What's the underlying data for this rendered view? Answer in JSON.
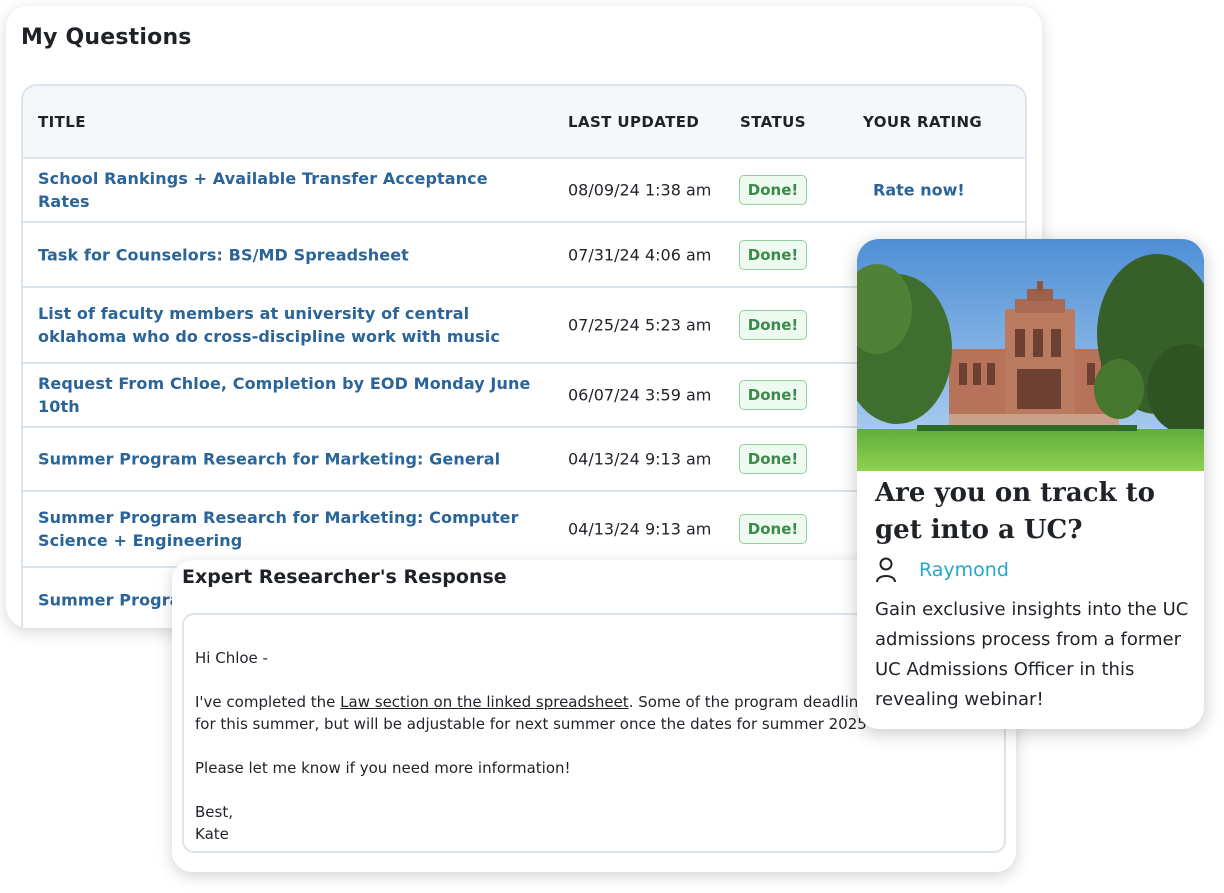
{
  "questions": {
    "title": "My Questions",
    "headers": {
      "title": "TITLE",
      "last_updated": "LAST UPDATED",
      "status": "STATUS",
      "rating": "YOUR RATING"
    },
    "rows": [
      {
        "title": "School Rankings + Available Transfer Acceptance Rates",
        "date": "08/09/24 1:38 am",
        "status": "Done!",
        "rating": "Rate now!"
      },
      {
        "title": "Task for Counselors: BS/MD Spreadsheet",
        "date": "07/31/24 4:06 am",
        "status": "Done!"
      },
      {
        "title": "List of faculty members at university of central oklahoma who do cross-discipline work with music",
        "date": "07/25/24 5:23 am",
        "status": "Done!"
      },
      {
        "title": "Request From Chloe, Completion by EOD Monday June 10th",
        "date": "06/07/24 3:59 am",
        "status": "Done!"
      },
      {
        "title": "Summer Program Research for Marketing: General",
        "date": "04/13/24 9:13 am",
        "status": "Done!"
      },
      {
        "title": "Summer Program Research for Marketing: Computer Science + Engineering",
        "date": "04/13/24 9:13 am",
        "status": "Done!"
      },
      {
        "title": "Summer Program"
      }
    ]
  },
  "response": {
    "heading": "Expert Researcher's Response",
    "greeting": "Hi Chloe -",
    "line1_prefix": "I've completed the ",
    "line1_link": "Law section on the linked spreadsheet",
    "line1_suffix": ". Some of the program deadlines",
    "line2": "for this summer, but will be adjustable for next summer once the dates for summer 2025",
    "line3": "Please let me know if you need more information!",
    "signoff": "Best,",
    "signature": "Kate"
  },
  "webinar": {
    "title": "Are you on track to get into a UC?",
    "author": "Raymond",
    "description": "Gain exclusive insights into the UC admissions process from a former UC Admissions Officer in this revealing webinar!"
  },
  "colors": {
    "link_blue": "#2a6498",
    "done_green": "#3a8a4a",
    "author_cyan": "#22a8c8"
  }
}
